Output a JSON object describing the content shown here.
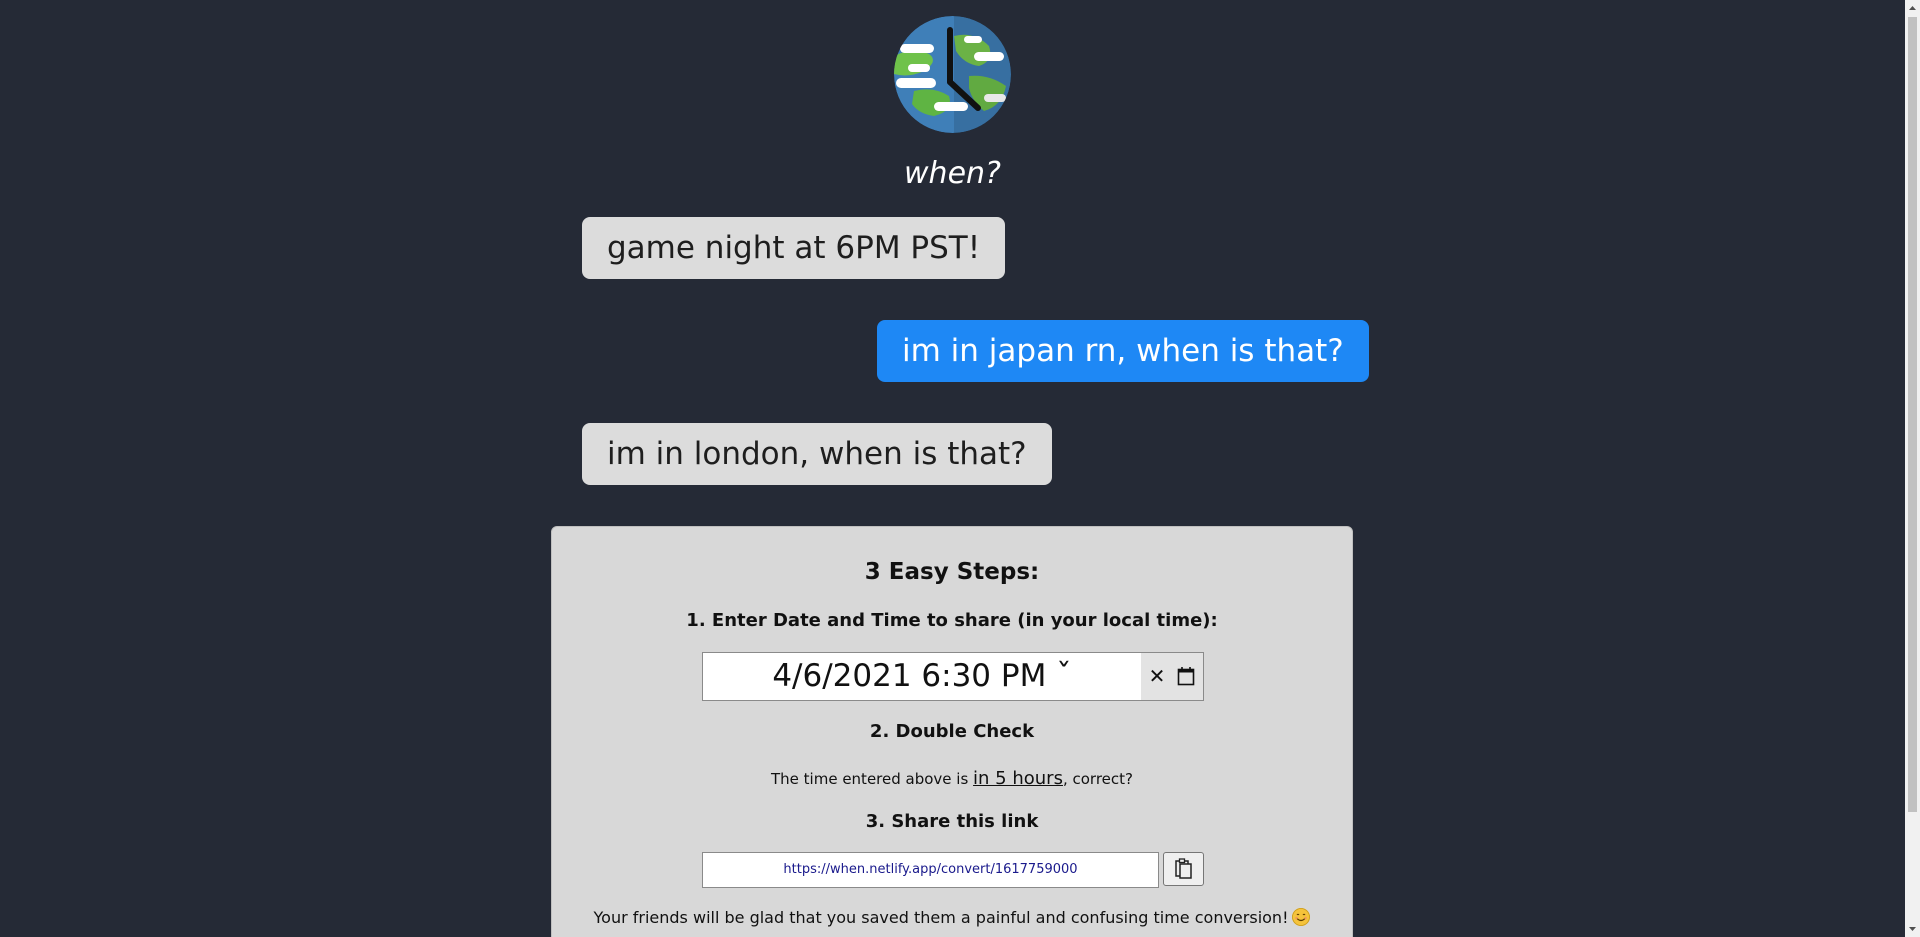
{
  "logo": {
    "icon": "globe-clock-icon"
  },
  "tagline": "when?",
  "chat": {
    "messages": [
      {
        "text": "game night at 6PM PST!",
        "style": "gray"
      },
      {
        "text": "im in japan rn, when is that?",
        "style": "blue"
      },
      {
        "text": "im in london, when is that?",
        "style": "gray"
      }
    ]
  },
  "steps": {
    "heading": "3 Easy Steps:",
    "step1_label": "1. Enter Date and Time to share (in your local time):",
    "datetime_value": "4/6/2021 6:30  PM ˇ",
    "clear_symbol": "✕",
    "step2_label": "2. Double Check",
    "check_prefix": "The time entered above is ",
    "check_relative": "in 5 hours",
    "check_suffix": ", correct?",
    "step3_label": "3. Share this link",
    "share_link": "https://when.netlify.app/convert/1617759000",
    "footer_text": "Your friends will be glad that you saved them a painful and confusing time conversion!"
  },
  "colors": {
    "background": "#252a36",
    "bubble_gray": "#dcdcdc",
    "bubble_blue": "#1e88f5",
    "card": "#d8d8d8"
  }
}
